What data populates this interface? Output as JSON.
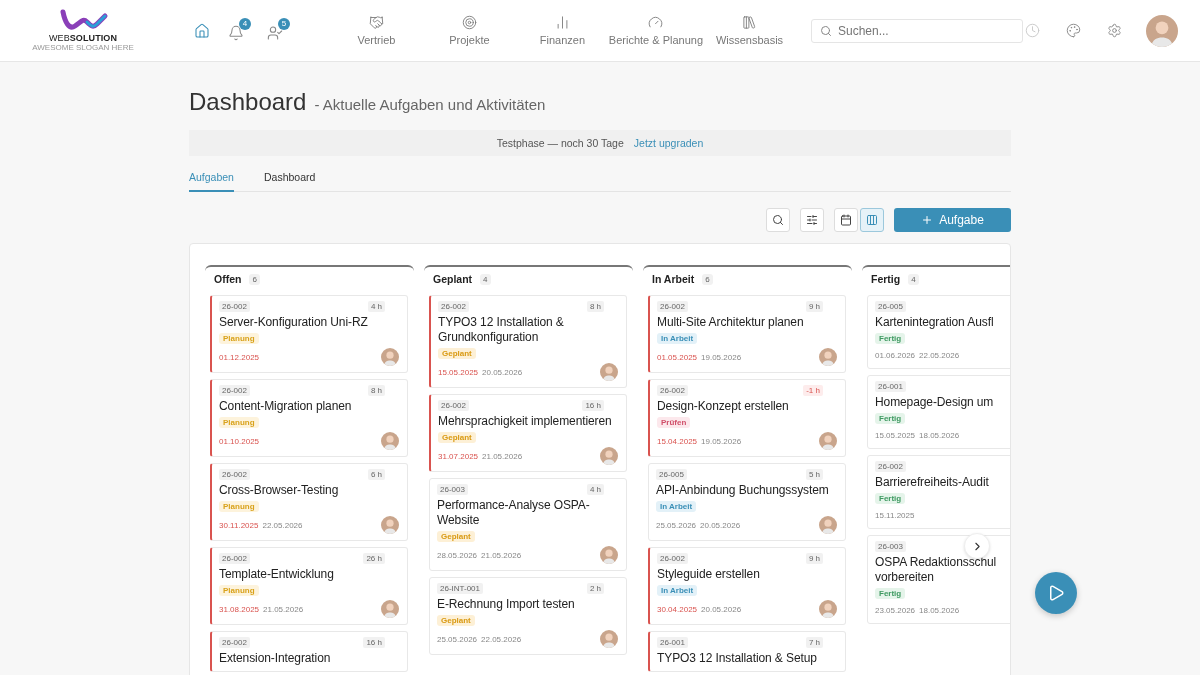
{
  "logo": {
    "word_light": "WEB",
    "word_bold": "SOLUTION",
    "slogan": "AWESOME SLOGAN HERE"
  },
  "nav_icons": [
    {
      "kind": "home",
      "selected": true
    },
    {
      "kind": "bell",
      "badge": "4",
      "selected": false
    },
    {
      "kind": "user",
      "badge": "5",
      "selected": false
    }
  ],
  "nav": [
    {
      "kind": "handshake",
      "label": "Vertrieb"
    },
    {
      "kind": "target",
      "label": "Projekte"
    },
    {
      "kind": "chart",
      "label": "Finanzen"
    },
    {
      "kind": "gauge",
      "label": "Berichte & Planung"
    },
    {
      "kind": "library",
      "label": "Wissensbasis"
    }
  ],
  "search": {
    "placeholder": "Suchen..."
  },
  "header_actions": [
    {
      "kind": "clock",
      "disabled": true
    },
    {
      "kind": "palette",
      "disabled": false
    },
    {
      "kind": "settings",
      "disabled": false
    }
  ],
  "page": {
    "title": "Dashboard",
    "subtitle": "- Aktuelle Aufgaben und Aktivitäten"
  },
  "banner": {
    "text": "Testphase — noch 30 Tage",
    "link": "Jetzt upgraden"
  },
  "tabs": [
    {
      "label": "Aufgaben",
      "selected": true
    },
    {
      "label": "Dashboard",
      "selected": false
    }
  ],
  "toolbar": {
    "tools": [
      {
        "kind": "search"
      },
      {
        "kind": "filter"
      }
    ],
    "views": [
      {
        "kind": "calendar",
        "selected": false
      },
      {
        "kind": "board",
        "selected": true
      }
    ],
    "add_button": "Aufgabe"
  },
  "columns": [
    {
      "title": "Offen",
      "count": "6",
      "cards": [
        {
          "project": "26-002",
          "hours": "4 h",
          "over_budget": false,
          "title": "Server-Konfiguration Uni-RZ",
          "status": "Planung",
          "kind": "planung",
          "overdue": true,
          "date": "01.12.2025",
          "avatar": true
        },
        {
          "project": "26-002",
          "hours": "8 h",
          "over_budget": false,
          "title": "Content-Migration planen",
          "status": "Planung",
          "kind": "planung",
          "overdue": true,
          "date": "01.10.2025",
          "avatar": true
        },
        {
          "project": "26-002",
          "hours": "6 h",
          "over_budget": false,
          "title": "Cross-Browser-Testing",
          "status": "Planung",
          "kind": "planung",
          "overdue": true,
          "date": "30.11.2025",
          "date2": "22.05.2026",
          "avatar": true
        },
        {
          "project": "26-002",
          "hours": "26 h",
          "over_budget": false,
          "title": "Template-Entwicklung",
          "status": "Planung",
          "kind": "planung",
          "overdue": true,
          "date": "31.08.2025",
          "date2": "21.05.2026",
          "avatar": true
        },
        {
          "project": "26-002",
          "hours": "16 h",
          "over_budget": false,
          "title": "Extension-Integration",
          "overdue": true
        }
      ]
    },
    {
      "title": "Geplant",
      "count": "4",
      "cards": [
        {
          "project": "26-002",
          "hours": "8 h",
          "over_budget": false,
          "title": "TYPO3 12 Installation & Grundkonfiguration",
          "status": "Geplant",
          "kind": "geplant",
          "overdue": true,
          "date": "15.05.2025",
          "date2": "20.05.2026",
          "avatar": true
        },
        {
          "project": "26-002",
          "hours": "16 h",
          "over_budget": false,
          "title": "Mehrsprachigkeit implementieren",
          "status": "Geplant",
          "kind": "geplant",
          "overdue": true,
          "date": "31.07.2025",
          "date2": "21.05.2026",
          "avatar": true
        },
        {
          "project": "26-003",
          "hours": "4 h",
          "over_budget": false,
          "title": "Performance-Analyse OSPA-Website",
          "status": "Geplant",
          "kind": "geplant",
          "overdue": false,
          "date": "28.05.2026",
          "date2": "21.05.2026",
          "avatar": true
        },
        {
          "project": "26-INT-001",
          "hours": "2 h",
          "over_budget": false,
          "title": "E-Rechnung Import testen",
          "status": "Geplant",
          "kind": "geplant",
          "overdue": false,
          "date": "25.05.2026",
          "date2": "22.05.2026",
          "avatar": true
        }
      ]
    },
    {
      "title": "In Arbeit",
      "count": "6",
      "cards": [
        {
          "project": "26-002",
          "hours": "9 h",
          "over_budget": false,
          "title": "Multi-Site Architektur planen",
          "status": "In Arbeit",
          "kind": "in_arbeit",
          "overdue": true,
          "date": "01.05.2025",
          "date2": "19.05.2026",
          "avatar": true
        },
        {
          "project": "26-002",
          "hours": "-1 h",
          "over_budget": true,
          "title": "Design-Konzept erstellen",
          "status": "Prüfen",
          "kind": "pruefen",
          "overdue": true,
          "date": "15.04.2025",
          "date2": "19.05.2026",
          "avatar": true
        },
        {
          "project": "26-005",
          "hours": "5 h",
          "over_budget": false,
          "title": "API-Anbindung Buchungssystem",
          "status": "In Arbeit",
          "kind": "in_arbeit",
          "overdue": false,
          "date": "25.05.2026",
          "date2": "20.05.2026",
          "avatar": true
        },
        {
          "project": "26-002",
          "hours": "9 h",
          "over_budget": false,
          "title": "Styleguide erstellen",
          "status": "In Arbeit",
          "kind": "in_arbeit",
          "overdue": true,
          "date": "30.04.2025",
          "date2": "20.05.2026",
          "avatar": true
        },
        {
          "project": "26-001",
          "hours": "7 h",
          "over_budget": false,
          "title": "TYPO3 12 Installation & Setup",
          "overdue": true
        }
      ]
    },
    {
      "title": "Fertig",
      "count": "4",
      "cards": [
        {
          "project": "26-005",
          "title": "Kartenintegration Ausfl",
          "status": "Fertig",
          "kind": "fertig",
          "overdue": false,
          "date": "01.06.2026",
          "date2": "22.05.2026",
          "avatar": false
        },
        {
          "project": "26-001",
          "title": "Homepage-Design um",
          "status": "Fertig",
          "kind": "fertig",
          "overdue": false,
          "date": "15.05.2025",
          "date2": "18.05.2026",
          "avatar": false
        },
        {
          "project": "26-002",
          "title": "Barrierefreiheits-Audit",
          "status": "Fertig",
          "kind": "fertig",
          "overdue": false,
          "date": "15.11.2025",
          "avatar": false
        },
        {
          "project": "26-003",
          "title": "OSPA Redaktionsschul vorbereiten",
          "status": "Fertig",
          "kind": "fertig",
          "overdue": false,
          "date": "23.05.2026",
          "date2": "18.05.2026",
          "avatar": false
        }
      ]
    }
  ]
}
